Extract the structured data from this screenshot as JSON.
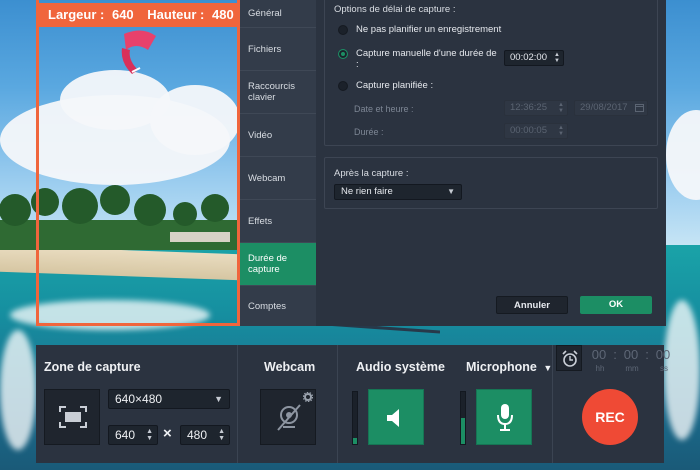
{
  "capture_frame": {
    "width_label": "Largeur :",
    "width_value": "640",
    "height_label": "Hauteur :",
    "height_value": "480"
  },
  "settings": {
    "nav": [
      {
        "label": "Général"
      },
      {
        "label": "Fichiers"
      },
      {
        "label": "Raccourcis clavier"
      },
      {
        "label": "Vidéo"
      },
      {
        "label": "Webcam"
      },
      {
        "label": "Effets"
      },
      {
        "label": "Durée de capture"
      },
      {
        "label": "Comptes"
      }
    ],
    "active_nav": "Durée de capture",
    "timing_group_title": "Options de délai de capture :",
    "options": [
      {
        "label": "Ne pas planifier un enregistrement",
        "selected": false
      },
      {
        "label": "Capture manuelle d'une durée de :",
        "selected": true
      },
      {
        "label": "Capture planifiée :",
        "selected": false
      }
    ],
    "manual_duration": "00:02:00",
    "date_time_label": "Date et heure :",
    "scheduled_time": "12:36:25",
    "scheduled_date": "29/08/2017",
    "duration_label": "Durée :",
    "scheduled_duration": "00:00:05",
    "after_group_title": "Après la capture :",
    "after_action": "Ne rien faire",
    "cancel_label": "Annuler",
    "ok_label": "OK"
  },
  "controls": {
    "capture_zone_title": "Zone de capture",
    "resolution": "640×480",
    "width": "640",
    "times_sign": "×",
    "height": "480",
    "webcam_title": "Webcam",
    "system_audio_title": "Audio système",
    "microphone_title": "Microphone",
    "microphone_caret": "▼",
    "rec_label": "REC",
    "timer": {
      "hh": "00",
      "mm": "00",
      "ss": "00",
      "sep": ":",
      "labels": [
        "hh",
        "mm",
        "ss"
      ]
    },
    "accent_color": "#1c8e64",
    "rec_color": "#ef4a35",
    "frame_color": "#f0653c",
    "system_audio_level": 0.12,
    "microphone_level": 0.5
  },
  "icons": [
    "fullscreen-icon",
    "webcam-off-icon",
    "gear-icon",
    "speaker-icon",
    "microphone-icon",
    "alarm-clock-icon",
    "calendar-icon"
  ]
}
